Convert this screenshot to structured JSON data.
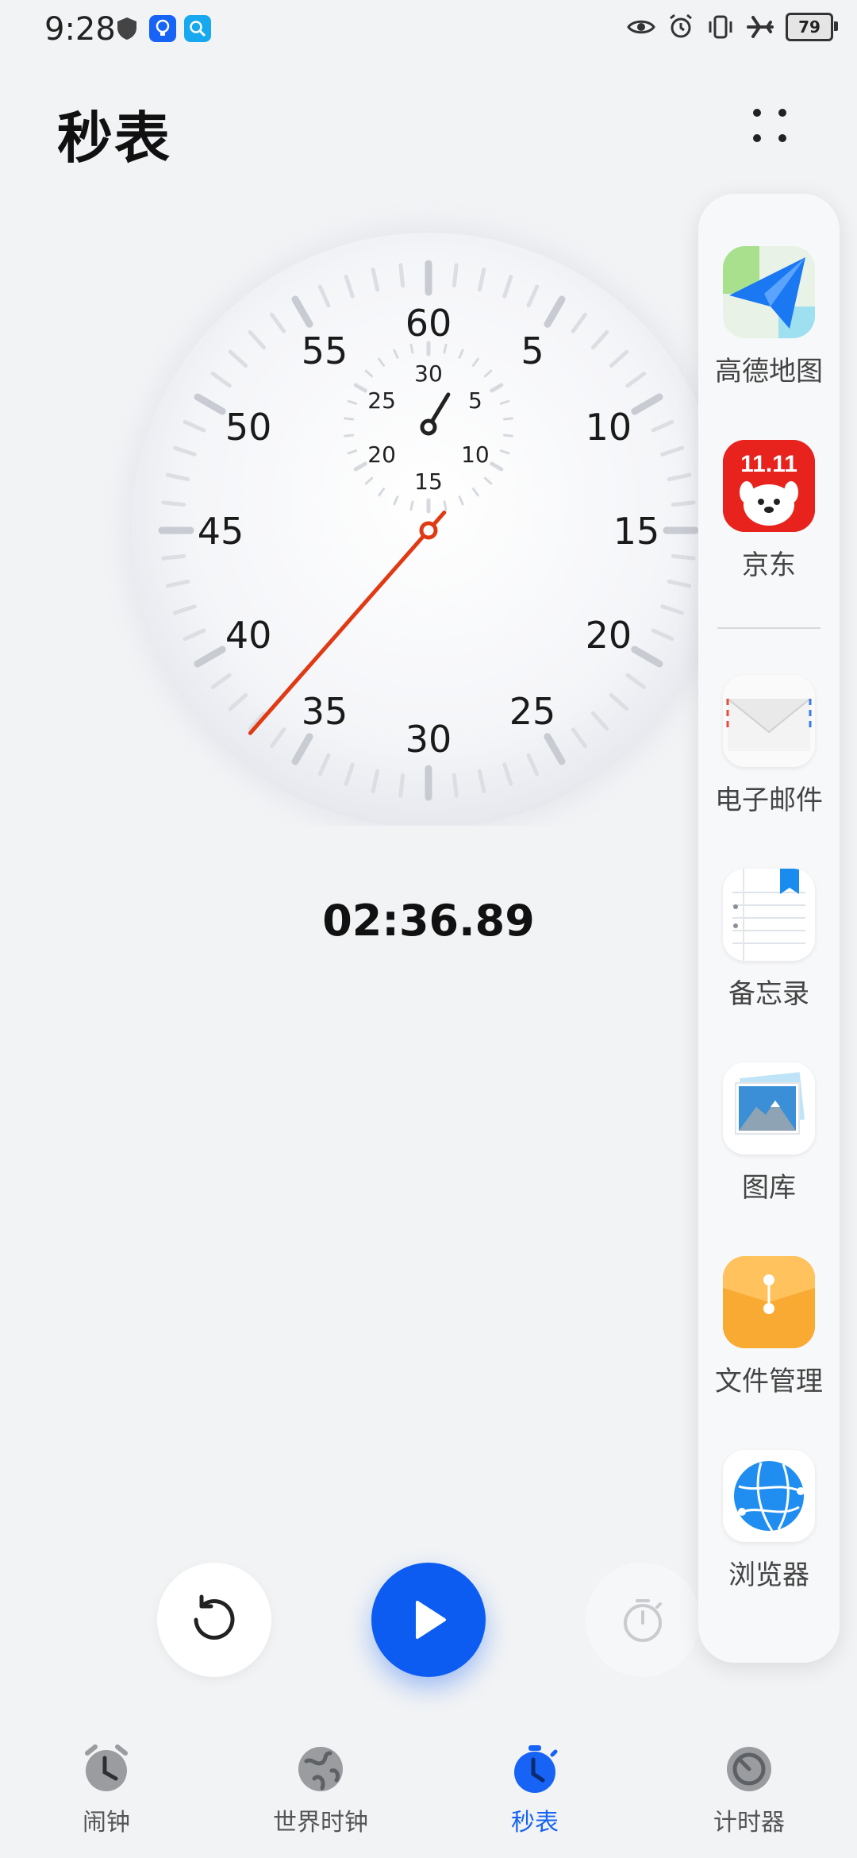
{
  "status_bar": {
    "time": "9:28",
    "battery": "79",
    "icons": [
      "shield-icon",
      "lightbulb-icon",
      "search-icon",
      "eye-icon",
      "alarm-icon",
      "vibrate-icon",
      "airplane-icon",
      "battery-icon"
    ]
  },
  "header": {
    "title": "秒表",
    "more_icon": "more-dots-icon"
  },
  "dial": {
    "outer_numbers": [
      "60",
      "5",
      "10",
      "15",
      "20",
      "25",
      "30",
      "35",
      "40",
      "45",
      "50",
      "55"
    ],
    "inner_numbers": [
      "30",
      "5",
      "10",
      "15",
      "20",
      "25"
    ],
    "hand_color": "#e03a14",
    "seconds_hand_value": 36.89,
    "minutes_hand_value": 2.6
  },
  "elapsed_time": "02:36.89",
  "controls": {
    "reset_icon": "reset-icon",
    "play_icon": "play-icon",
    "lap_icon": "lap-stopwatch-icon",
    "accent_color": "#0d5cf2"
  },
  "tabs": [
    {
      "label": "闹钟",
      "icon": "alarm-clock-icon",
      "active": false
    },
    {
      "label": "世界时钟",
      "icon": "globe-icon",
      "active": false
    },
    {
      "label": "秒表",
      "icon": "stopwatch-icon",
      "active": true
    },
    {
      "label": "计时器",
      "icon": "timer-icon",
      "active": false
    }
  ],
  "side_panel": {
    "apps": [
      {
        "label": "高德地图",
        "icon": "amap-icon"
      },
      {
        "label": "京东",
        "icon": "jd-icon",
        "icon_text": "11.11"
      },
      {
        "label": "电子邮件",
        "icon": "email-icon"
      },
      {
        "label": "备忘录",
        "icon": "notes-icon"
      },
      {
        "label": "图库",
        "icon": "gallery-icon"
      },
      {
        "label": "文件管理",
        "icon": "file-manager-icon"
      },
      {
        "label": "浏览器",
        "icon": "browser-icon"
      }
    ]
  }
}
